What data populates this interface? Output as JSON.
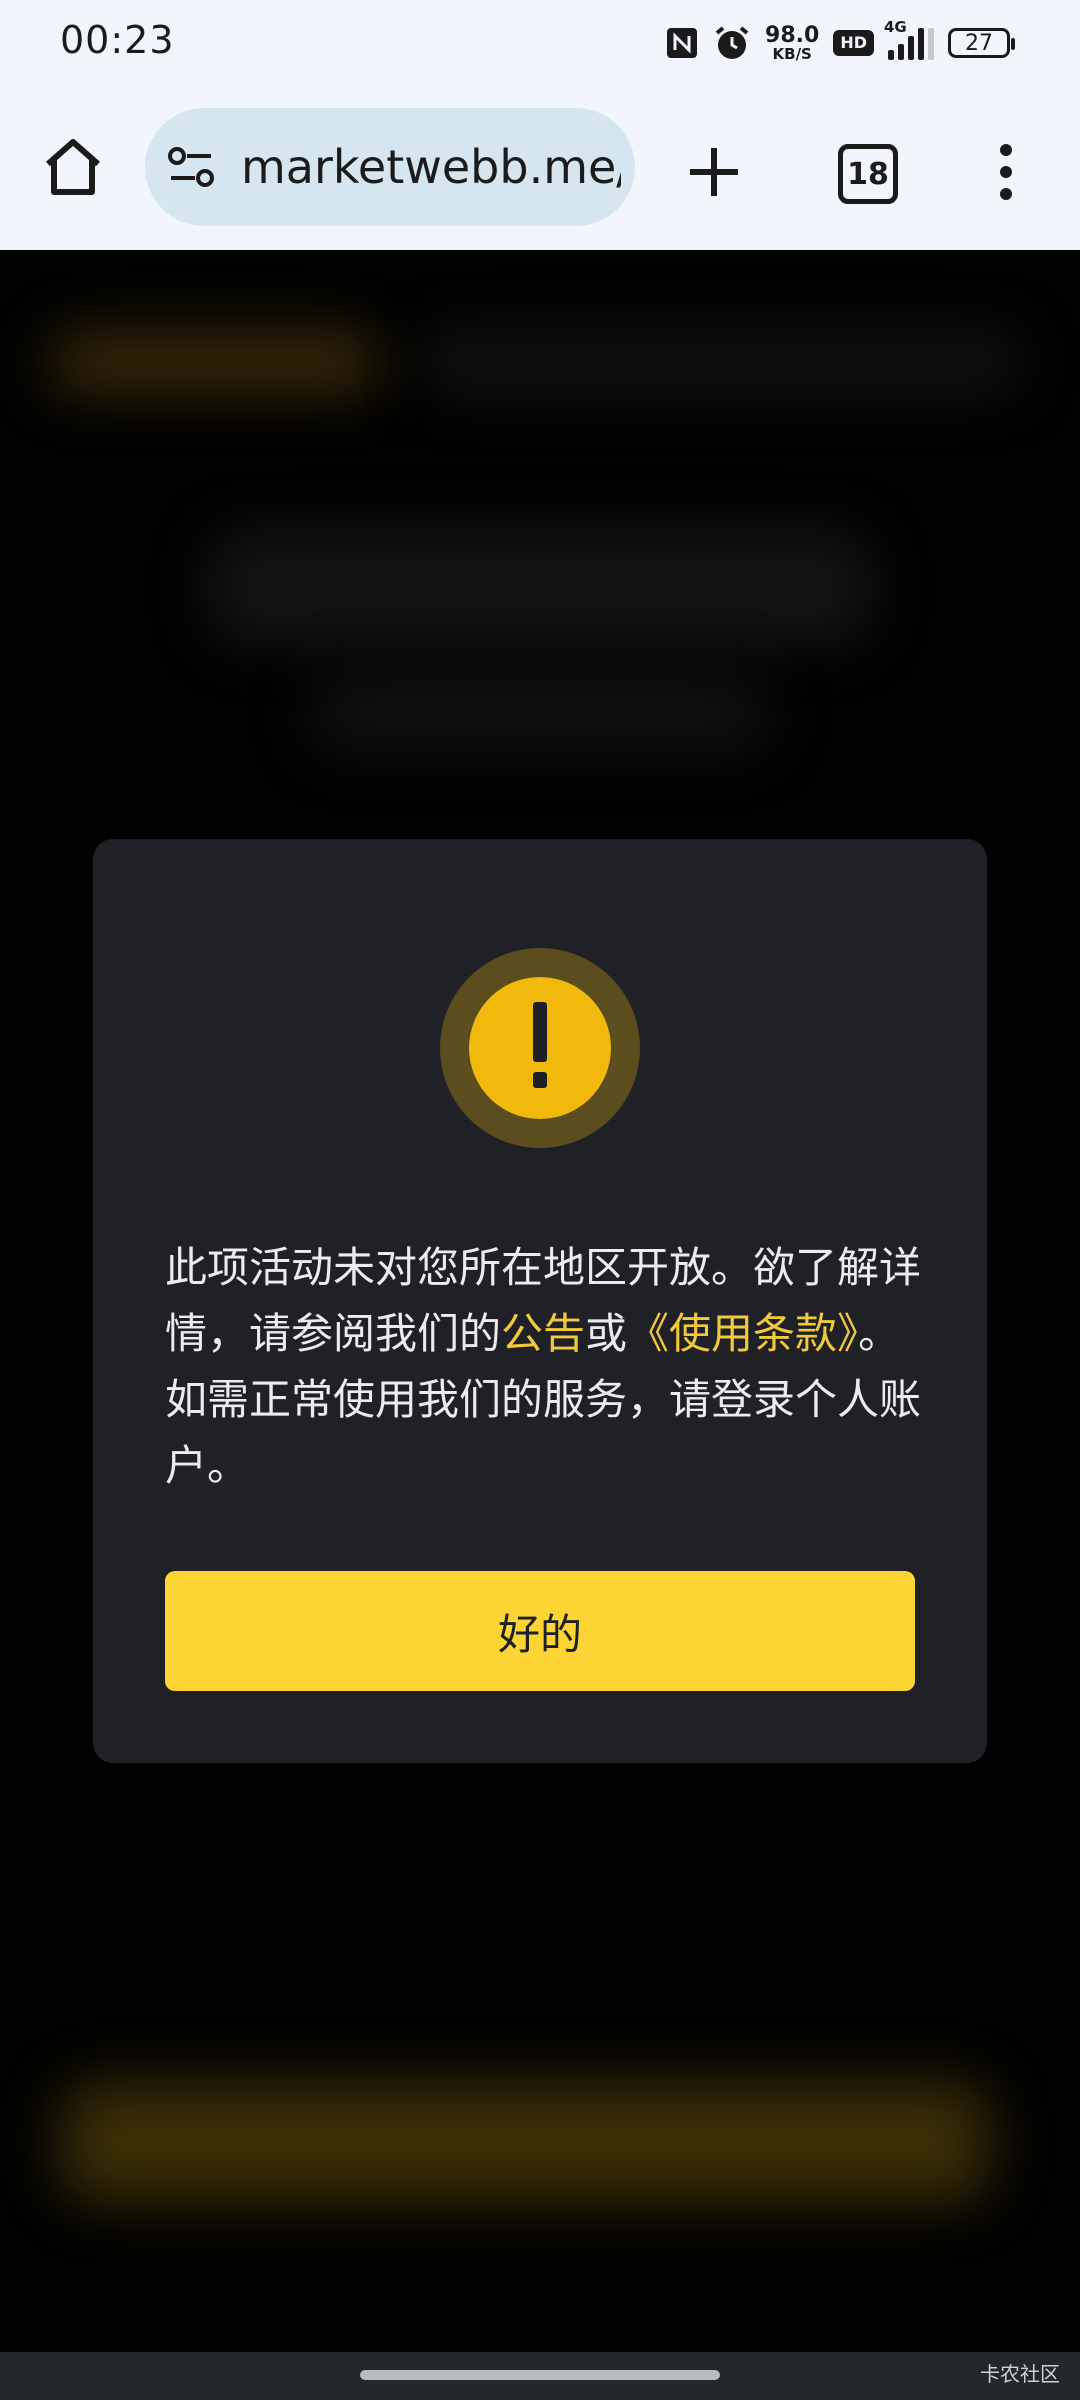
{
  "status_bar": {
    "time": "00:23",
    "net_speed_value": "98.0",
    "net_speed_unit": "KB/S",
    "hd_badge": "HD",
    "network_type": "4G",
    "battery_level": "27",
    "icons": [
      "nfc-icon",
      "alarm-icon",
      "signal-icon",
      "battery-icon"
    ]
  },
  "browser": {
    "url": "marketwebb.me/zh-CN",
    "tab_count": "18",
    "load_progress_percent": 5,
    "icons": [
      "home-icon",
      "site-settings-icon",
      "plus-icon",
      "tab-switcher-icon",
      "more-vert-icon"
    ]
  },
  "modal": {
    "icon": "warning-icon",
    "message_part1": "此项活动未对您所在地区开放。欲了解详情，请参阅我们的",
    "link_announcement": "公告",
    "connector": "或",
    "link_terms": "《使用条款》",
    "message_part2": "。如需正常使用我们的服务，请登录个人账户。",
    "ok_label": "好的"
  },
  "footer": {
    "watermark": "卡农社区"
  },
  "colors": {
    "accent": "#fcd535",
    "link": "#f0c93d",
    "warning": "#f0b90b",
    "modal_bg": "#1f2127",
    "progress": "#1a73c8"
  }
}
